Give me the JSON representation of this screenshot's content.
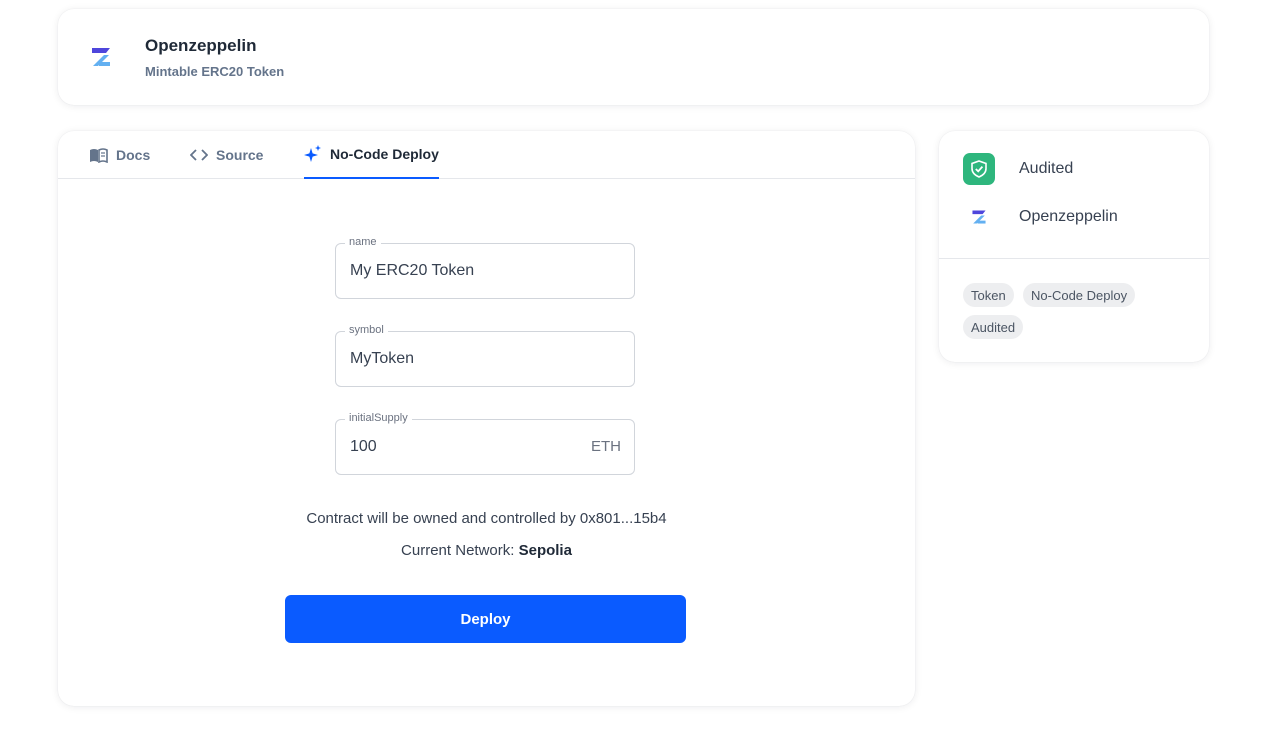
{
  "header": {
    "title": "Openzeppelin",
    "subtitle": "Mintable ERC20 Token",
    "logo_icon": "openzeppelin-logo-icon"
  },
  "tabs": [
    {
      "label": "Docs",
      "icon": "book-icon",
      "active": false
    },
    {
      "label": "Source",
      "icon": "code-icon",
      "active": false
    },
    {
      "label": "No-Code Deploy",
      "icon": "sparkles-icon",
      "active": true
    }
  ],
  "form": {
    "fields": [
      {
        "label": "name",
        "value": "My ERC20 Token"
      },
      {
        "label": "symbol",
        "value": "MyToken"
      },
      {
        "label": "initialSupply",
        "value": "100",
        "suffix": "ETH"
      }
    ],
    "owner_text": "Contract will be owned and controlled by 0x801...15b4",
    "network_prefix": "Current Network: ",
    "network_name": "Sepolia",
    "deploy_label": "Deploy"
  },
  "sidebar": {
    "audited_label": "Audited",
    "publisher_label": "Openzeppelin",
    "tags": [
      "Token",
      "No-Code Deploy",
      "Audited"
    ]
  },
  "colors": {
    "accent": "#0a5bff",
    "audited_green": "#2eb67d",
    "logo_dark": "#4e46dc",
    "logo_light": "#63b0f1"
  }
}
